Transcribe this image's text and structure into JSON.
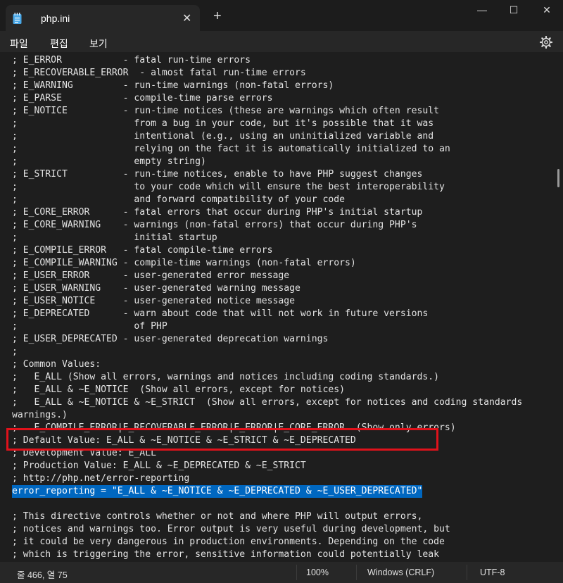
{
  "tab": {
    "title": "php.ini",
    "close": "✕",
    "new_tab": "+"
  },
  "window": {
    "minimize": "—",
    "maximize": "☐",
    "close": "✕"
  },
  "menu": {
    "file": "파일",
    "edit": "편집",
    "view": "보기"
  },
  "editor": {
    "lines": [
      "; E_ERROR           - fatal run-time errors",
      "; E_RECOVERABLE_ERROR  - almost fatal run-time errors",
      "; E_WARNING         - run-time warnings (non-fatal errors)",
      "; E_PARSE           - compile-time parse errors",
      "; E_NOTICE          - run-time notices (these are warnings which often result",
      ";                     from a bug in your code, but it's possible that it was",
      ";                     intentional (e.g., using an uninitialized variable and",
      ";                     relying on the fact it is automatically initialized to an",
      ";                     empty string)",
      "; E_STRICT          - run-time notices, enable to have PHP suggest changes",
      ";                     to your code which will ensure the best interoperability",
      ";                     and forward compatibility of your code",
      "; E_CORE_ERROR      - fatal errors that occur during PHP's initial startup",
      "; E_CORE_WARNING    - warnings (non-fatal errors) that occur during PHP's",
      ";                     initial startup",
      "; E_COMPILE_ERROR   - fatal compile-time errors",
      "; E_COMPILE_WARNING - compile-time warnings (non-fatal errors)",
      "; E_USER_ERROR      - user-generated error message",
      "; E_USER_WARNING    - user-generated warning message",
      "; E_USER_NOTICE     - user-generated notice message",
      "; E_DEPRECATED      - warn about code that will not work in future versions",
      ";                     of PHP",
      "; E_USER_DEPRECATED - user-generated deprecation warnings",
      ";",
      "; Common Values:",
      ";   E_ALL (Show all errors, warnings and notices including coding standards.)",
      ";   E_ALL & ~E_NOTICE  (Show all errors, except for notices)",
      ";   E_ALL & ~E_NOTICE & ~E_STRICT  (Show all errors, except for notices and coding standards",
      "warnings.)",
      ";   E_COMPILE_ERROR|E_RECOVERABLE_ERROR|E_ERROR|E_CORE_ERROR  (Show only errors)",
      "; Default Value: E_ALL & ~E_NOTICE & ~E_STRICT & ~E_DEPRECATED",
      "; Development Value: E_ALL",
      "; Production Value: E_ALL & ~E_DEPRECATED & ~E_STRICT",
      "; http://php.net/error-reporting",
      "error_reporting = \"E_ALL & ~E_NOTICE & ~E_DEPRECATED & ~E_USER_DEPRECATED\"",
      "",
      "; This directive controls whether or not and where PHP will output errors,",
      "; notices and warnings too. Error output is very useful during development, but",
      "; it could be very dangerous in production environments. Depending on the code",
      "; which is triggering the error, sensitive information could potentially leak"
    ],
    "selected_line": 34
  },
  "status": {
    "position": "줄 466, 열 75",
    "zoom": "100%",
    "line_ending": "Windows (CRLF)",
    "encoding": "UTF-8"
  },
  "colors": {
    "selection": "#0067c0",
    "highlight_border": "#e0121b"
  }
}
